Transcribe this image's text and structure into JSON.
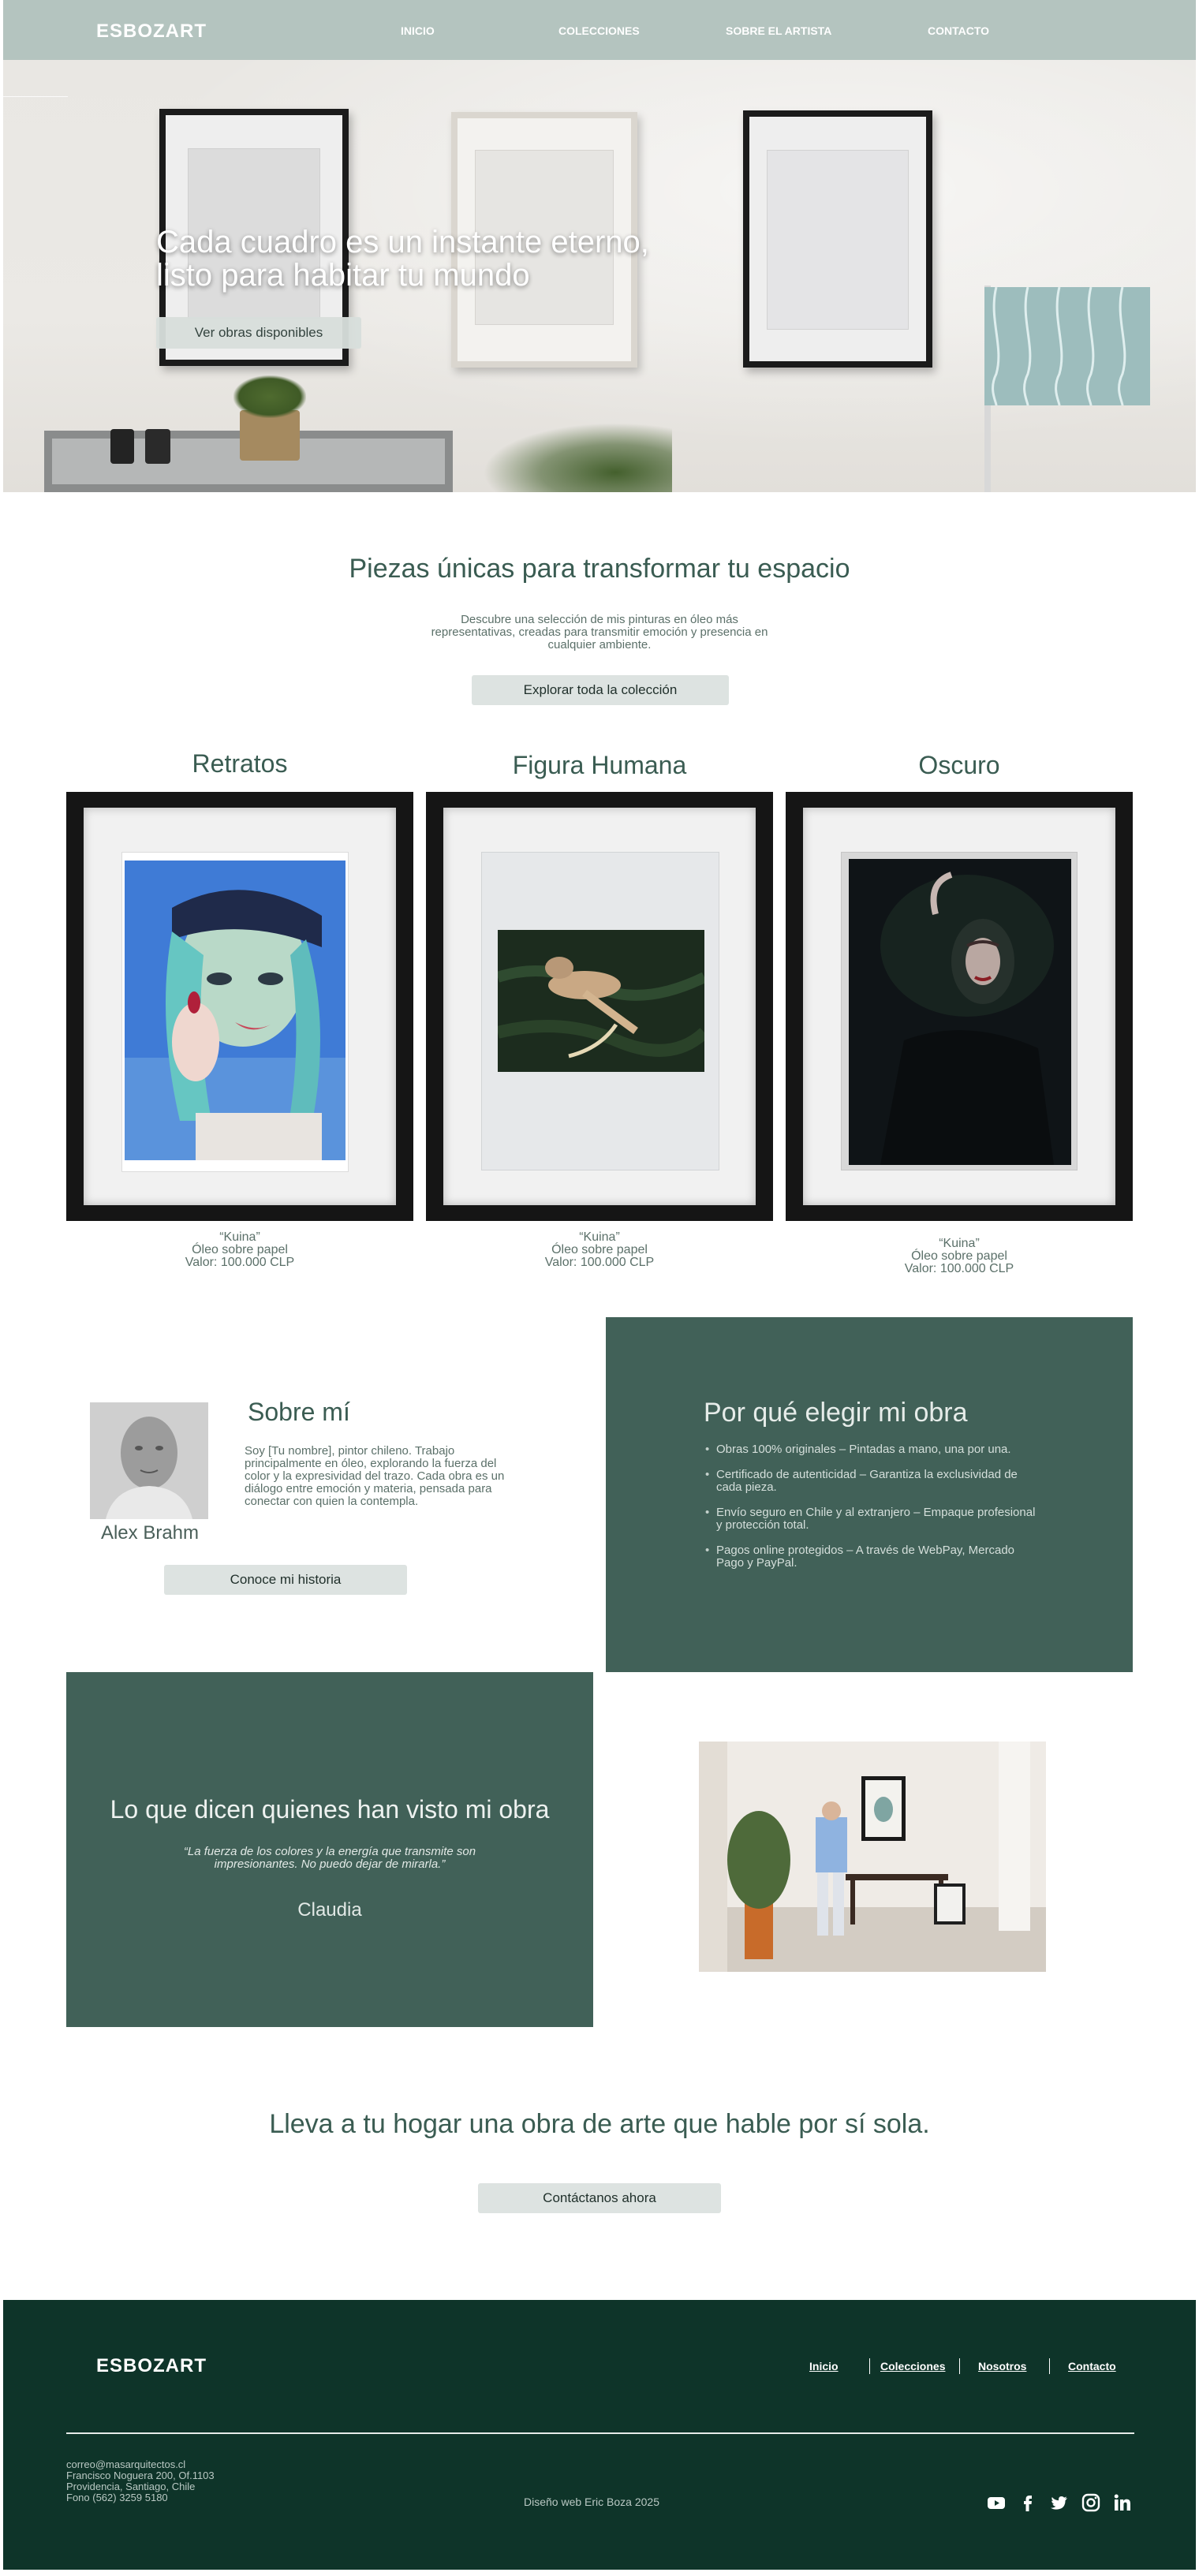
{
  "brand": {
    "logo": "ESBOZART"
  },
  "nav": {
    "links": [
      "INICIO",
      "COLECCIONES",
      "SOBRE EL ARTISTA",
      "CONTACTO"
    ]
  },
  "hero": {
    "headline_line1": "Cada cuadro es un instante eterno,",
    "headline_line2": "listo para habitar tu mundo",
    "button": "Ver obras disponibles"
  },
  "intro": {
    "title": "Piezas únicas para transformar tu espacio",
    "description": "Descubre una selección de mis pinturas en óleo más representativas, creadas para transmitir emoción y presencia en cualquier ambiente.",
    "button": "Explorar toda la colección"
  },
  "gallery": {
    "items": [
      {
        "category": "Retratos",
        "name": "“Kuina”",
        "medium": "Óleo sobre papel",
        "price": "Valor: 100.000 CLP"
      },
      {
        "category": "Figura Humana",
        "name": "“Kuina”",
        "medium": "Óleo sobre papel",
        "price": "Valor: 100.000 CLP"
      },
      {
        "category": "Oscuro",
        "name": "“Kuina”",
        "medium": "Óleo sobre papel",
        "price": "Valor: 100.000 CLP"
      }
    ]
  },
  "about": {
    "title": "Sobre mí",
    "name": "Alex Brahm",
    "text": "Soy [Tu nombre], pintor chileno. Trabajo principalmente en óleo, explorando la fuerza del color y la expresividad del trazo. Cada obra es un diálogo entre emoción y materia, pensada para conectar con quien la contempla.",
    "button": "Conoce mi historia"
  },
  "why": {
    "title": "Por qué elegir mi obra",
    "items": [
      "Obras 100% originales – Pintadas a mano, una por una.",
      "Certificado de autenticidad – Garantiza la exclusividad de cada pieza.",
      "Envío seguro en Chile y al extranjero – Empaque profesional y protección total.",
      "Pagos online protegidos – A través de WebPay, Mercado Pago y PayPal."
    ]
  },
  "testimonial": {
    "title": "Lo que dicen quienes han visto mi obra",
    "quote": "“La fuerza de los colores y la energía que transmite son impresionantes. No puedo dejar de mirarla.”",
    "author": "Claudia"
  },
  "cta": {
    "title": "Lleva a tu hogar una obra de arte que hable por sí sola.",
    "button": "Contáctanos ahora"
  },
  "footer": {
    "logo": "ESBOZART",
    "links": [
      "Inicio",
      "Colecciones",
      "Nosotros",
      "Contacto"
    ],
    "email": "correo@masarquitectos.cl",
    "address1": "Francisco Noguera 200, Of.1103",
    "address2": "Providencia, Santiago, Chile",
    "phone": "Fono (562) 3259 5180",
    "credit": "Diseño web Eric Boza 2025",
    "social_icons": [
      "youtube-icon",
      "facebook-icon",
      "twitter-icon",
      "instagram-icon",
      "linkedin-icon"
    ]
  },
  "colors": {
    "nav_bg": "#b4c4bf",
    "accent_panel": "#416158",
    "footer_bg": "#0e3429",
    "heading_text": "#3a5c52",
    "button_bg": "#dde3e1"
  }
}
